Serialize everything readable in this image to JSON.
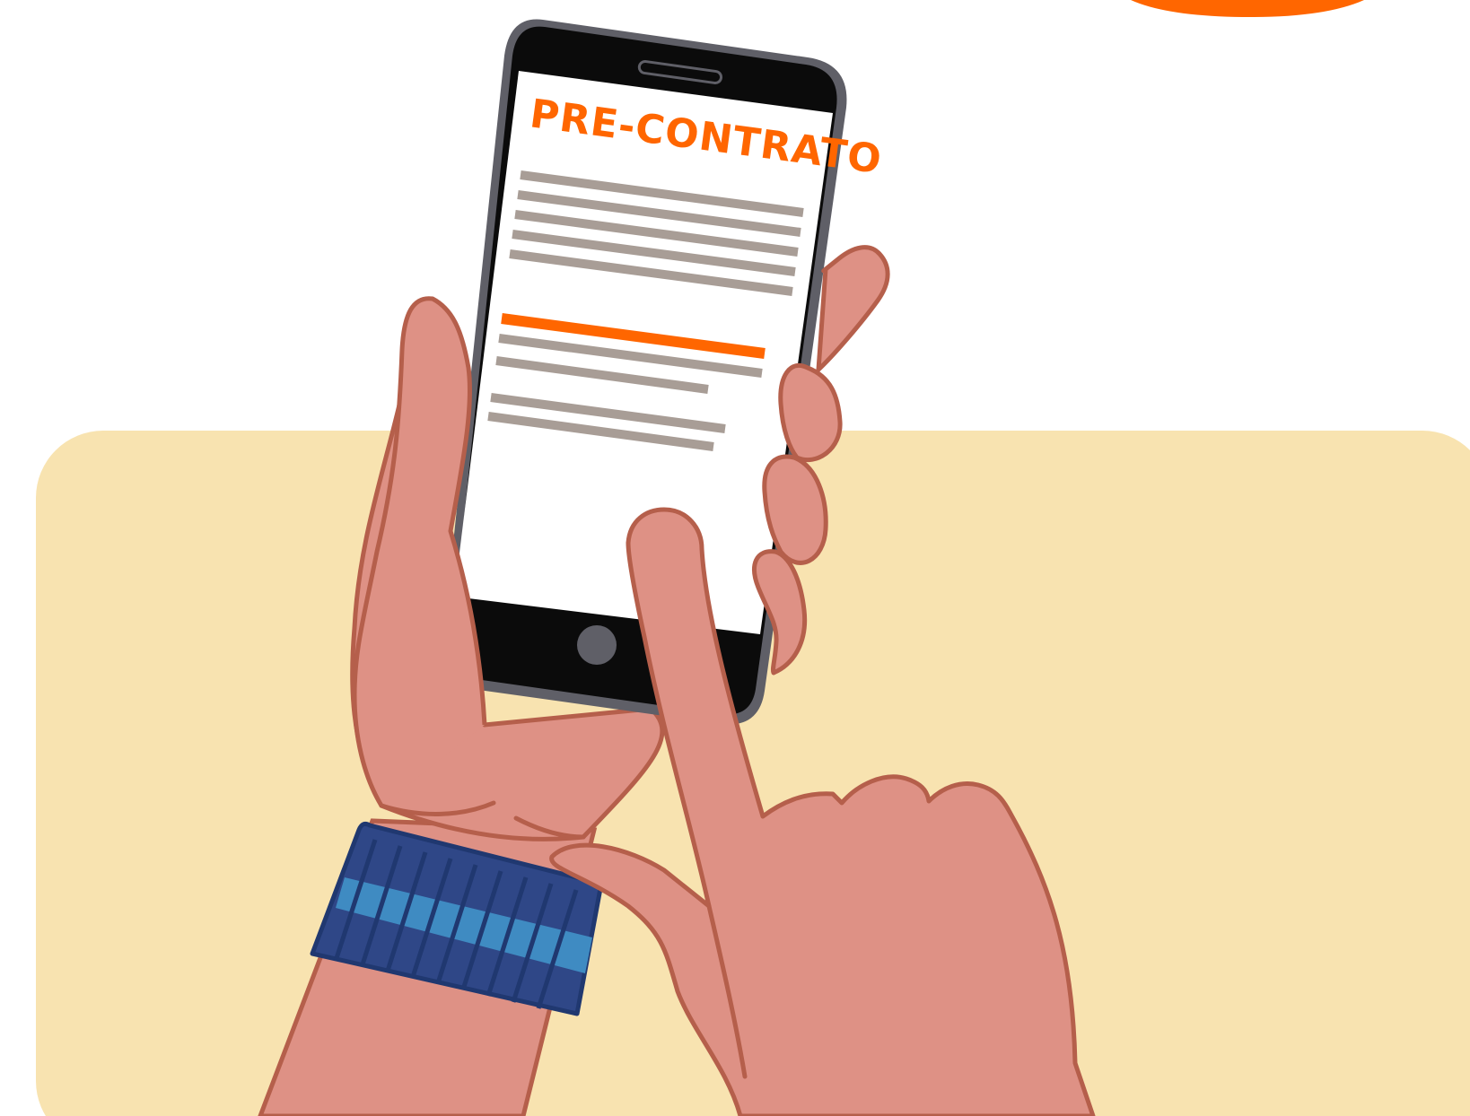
{
  "phone": {
    "document_title": "PRE-CONTRATO"
  },
  "colors": {
    "background": "#ffffff",
    "panel": "#f8e3b0",
    "accent": "#ff6600",
    "skin": "#de9185",
    "skin_outline": "#b55f4b",
    "phone_body": "#0b0b0b",
    "phone_frame": "#5f5f67",
    "screen": "#ffffff",
    "text_line": "#a89d96",
    "strap_dark": "#2f4787",
    "strap_light": "#3f8bc2",
    "strap_outline": "#203870"
  },
  "icons": {
    "speaker": "speaker-grille-icon",
    "home_button": "home-button-icon"
  }
}
